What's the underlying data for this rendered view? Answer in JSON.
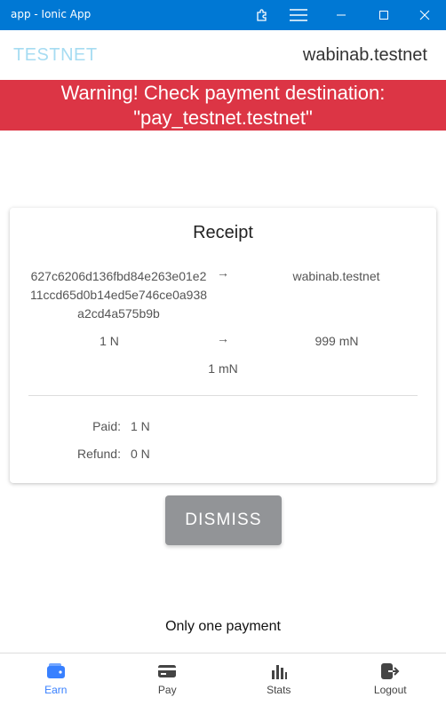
{
  "window": {
    "title": "app - Ionic App"
  },
  "header": {
    "brand": "TESTNET",
    "account": "wabinab.testnet"
  },
  "warning": {
    "line1": "Warning! Check payment destination:",
    "line2": "\"pay_testnet.testnet\""
  },
  "receipt": {
    "title": "Receipt",
    "txid": "627c6206d136fbd84e263e01e211ccd65d0b14ed5e746ce0a938a2cd4a575b9b",
    "destination": "wabinab.testnet",
    "amount_in": "1 N",
    "amount_out": "999 mN",
    "fee": "1 mN",
    "arrow": "→",
    "paid_label": "Paid:",
    "paid_value": "1 N",
    "refund_label": "Refund:",
    "refund_value": "0 N"
  },
  "dismiss_label": "DISMISS",
  "note": "Only one payment",
  "tabs": [
    {
      "label": "Earn",
      "icon": "wallet-icon",
      "active": true
    },
    {
      "label": "Pay",
      "icon": "card-icon",
      "active": false
    },
    {
      "label": "Stats",
      "icon": "stats-icon",
      "active": false
    },
    {
      "label": "Logout",
      "icon": "logout-icon",
      "active": false
    }
  ],
  "colors": {
    "titlebar": "#0078d4",
    "warning": "#dc3545",
    "brand": "#a6dcf2",
    "active_tab": "#3880ff",
    "dismiss": "#929497"
  }
}
